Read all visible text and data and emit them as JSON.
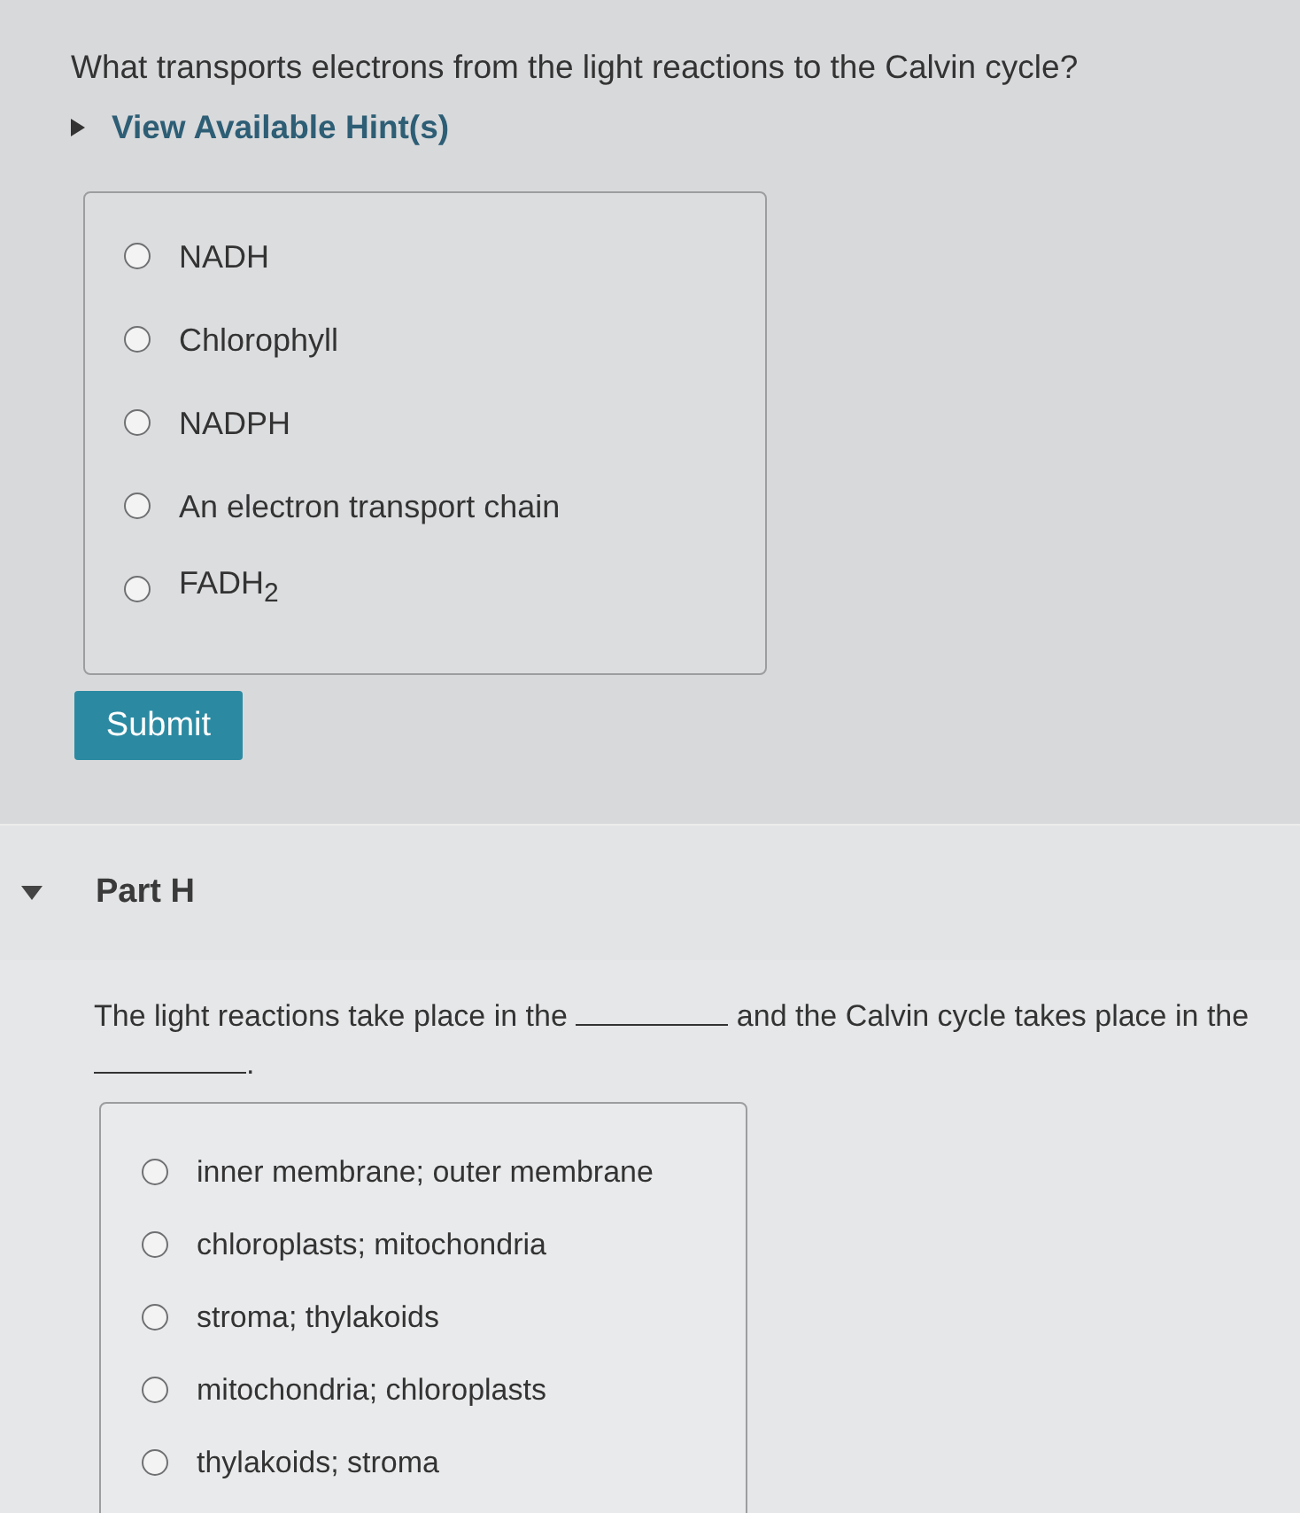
{
  "question": {
    "text": "What transports electrons from the light reactions to the Calvin cycle?",
    "hint_link": {
      "label": "View Available Hint(s)",
      "expanded": false
    },
    "options": [
      {
        "label": "NADH",
        "selected": false
      },
      {
        "label": "Chlorophyll",
        "selected": false
      },
      {
        "label": "NADPH",
        "selected": false
      },
      {
        "label": "An electron transport chain",
        "selected": false
      },
      {
        "label": "FADH$_{2}$",
        "selected": false
      }
    ],
    "submit_button": "Submit"
  },
  "part_h": {
    "title": "Part H",
    "expanded": true,
    "sentence": [
      {
        "kind": "text",
        "text": "The light reactions take place in the"
      },
      {
        "kind": "blank"
      },
      {
        "kind": "text",
        "text": "and the Calvin cycle takes place in the"
      },
      {
        "kind": "blank"
      },
      {
        "kind": "text",
        "text": "."
      }
    ],
    "options": [
      {
        "label": "inner membrane; outer membrane",
        "selected": false
      },
      {
        "label": "chloroplasts; mitochondria",
        "selected": false
      },
      {
        "label": "stroma; thylakoids",
        "selected": false
      },
      {
        "label": "mitochondria; chloroplasts",
        "selected": false
      },
      {
        "label": "thylakoids; stroma",
        "selected": false
      }
    ]
  }
}
